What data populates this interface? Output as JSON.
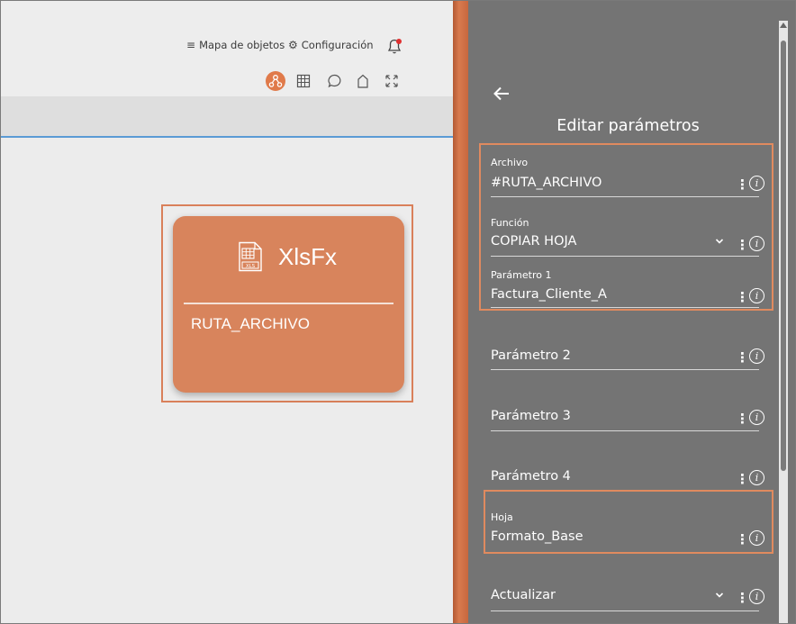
{
  "header": {
    "object_map_label": "Mapa de objetos",
    "settings_label": "Configuración"
  },
  "toolbar": {
    "icons": [
      "flow-icon",
      "grid-icon",
      "chat-icon",
      "home-icon",
      "expand-icon"
    ]
  },
  "node": {
    "title": "XlsFx",
    "icon_badge": "XLS",
    "value": "RUTA_ARCHIVO"
  },
  "panel": {
    "title": "Editar parámetros",
    "fields": [
      {
        "label": "Archivo",
        "value": "#RUTA_ARCHIVO",
        "has_dropdown": false
      },
      {
        "label": "Función",
        "value": "COPIAR HOJA",
        "has_dropdown": true
      },
      {
        "label": "Parámetro 1",
        "value": "Factura_Cliente_A",
        "has_dropdown": false
      },
      {
        "label": "",
        "value": "",
        "placeholder": "Parámetro 2",
        "has_dropdown": false
      },
      {
        "label": "",
        "value": "",
        "placeholder": "Parámetro 3",
        "has_dropdown": false
      },
      {
        "label": "",
        "value": "",
        "placeholder": "Parámetro 4",
        "has_dropdown": false
      },
      {
        "label": "Hoja",
        "value": "Formato_Base",
        "has_dropdown": false
      },
      {
        "label": "",
        "value": "",
        "placeholder": "Actualizar",
        "has_dropdown": true
      }
    ],
    "info_glyph": "i",
    "kebab_glyph": "⋮"
  },
  "colors": {
    "accent": "#d8845c",
    "highlight": "#e08a5f",
    "panel_bg": "#747474",
    "canvas_bg": "#ececec",
    "tab_line": "#5b9bd5"
  }
}
